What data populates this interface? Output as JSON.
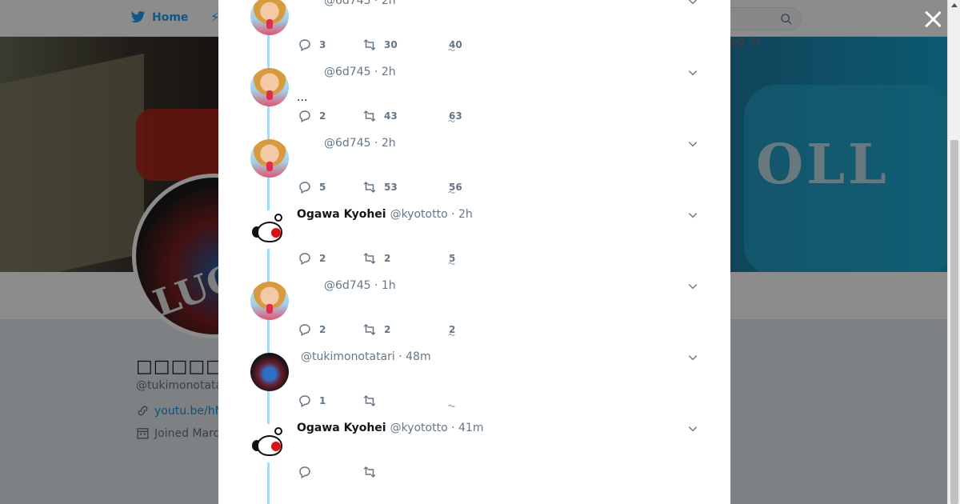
{
  "nav": {
    "home_label": "Home",
    "login_label": "Log in"
  },
  "profile": {
    "name": "□□□□□□□",
    "handle": "@tukimonotatari",
    "link": "youtu.be/hM",
    "joined": "Joined Marc"
  },
  "banner_text": "OLL",
  "avatar_text": "LUCI",
  "tweets": [
    {
      "fullname": "",
      "handle": "@6d745",
      "time": "2h",
      "text": "",
      "reply": "3",
      "retweet": "30",
      "like": "40",
      "avatar": "woman"
    },
    {
      "fullname": "",
      "handle": "@6d745",
      "time": "2h",
      "text": "...",
      "reply": "2",
      "retweet": "43",
      "like": "63",
      "avatar": "woman"
    },
    {
      "fullname": "",
      "handle": "@6d745",
      "time": "2h",
      "text": "",
      "reply": "5",
      "retweet": "53",
      "like": "56",
      "avatar": "woman"
    },
    {
      "fullname": "Ogawa Kyohei",
      "handle": "@kyototto",
      "time": "2h",
      "text": "",
      "reply": "2",
      "retweet": "2",
      "like": "5",
      "avatar": "dog"
    },
    {
      "fullname": "",
      "handle": "@6d745",
      "time": "1h",
      "text": "",
      "reply": "2",
      "retweet": "2",
      "like": "2",
      "avatar": "woman"
    },
    {
      "fullname": "",
      "handle": "@tukimonotatari",
      "time": "48m",
      "text": "",
      "reply": "1",
      "retweet": "",
      "like": "",
      "avatar": "lucifer"
    },
    {
      "fullname": "Ogawa Kyohei",
      "handle": "@kyototto",
      "time": "41m",
      "text": "",
      "reply": "",
      "retweet": "",
      "like": "",
      "avatar": "dog"
    }
  ],
  "colors": {
    "accent": "#1da1f2",
    "thread_line": "#a8d9f6",
    "muted": "#657786"
  },
  "icons": [
    "twitter-bird-icon",
    "search-icon",
    "close-icon",
    "reply-icon",
    "retweet-icon",
    "chevron-down-icon",
    "link-icon",
    "calendar-icon"
  ]
}
